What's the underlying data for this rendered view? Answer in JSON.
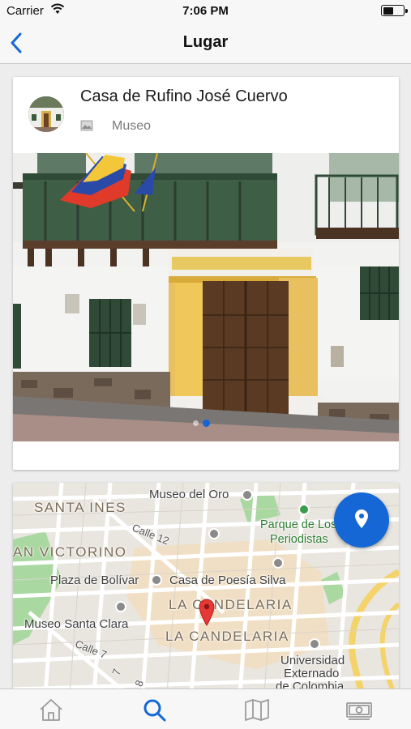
{
  "status_bar": {
    "carrier": "Carrier",
    "time": "7:06 PM"
  },
  "nav": {
    "title": "Lugar",
    "back_icon": "chevron-left-icon"
  },
  "place": {
    "name": "Casa de Rufino José Cuervo",
    "category": "Museo",
    "category_icon": "image-icon",
    "photo_pages": 2,
    "active_photo": 2
  },
  "map": {
    "labels": {
      "museo_del_oro": "Museo del Oro",
      "santa_ines": "SANTA INES",
      "calle_12": "Calle 12",
      "parque": "Parque de Los",
      "periodistas": "Periodistas",
      "san_victorino": "AN VICTORINO",
      "plaza_bolivar": "Plaza de Bolívar",
      "casa_poesia": "Casa de Poesía Silva",
      "la_candelaria_1": "LA CANDELARIA",
      "la_candelaria_2": "LA CANDELARIA",
      "museo_santa_clara": "Museo Santa Clara",
      "calle_7": "Calle 7",
      "universidad_1": "Universidad",
      "universidad_2": "Externado",
      "universidad_3": "de Colombia",
      "carrera_7": "7",
      "carrera_8": "8"
    },
    "fab_icon": "location-pin-icon"
  },
  "tabs": [
    {
      "name": "home",
      "icon": "home-icon",
      "active": false
    },
    {
      "name": "search",
      "icon": "search-icon",
      "active": true
    },
    {
      "name": "map",
      "icon": "map-icon",
      "active": false
    },
    {
      "name": "money",
      "icon": "banknote-icon",
      "active": false
    }
  ],
  "colors": {
    "accent": "#1467d4",
    "tab_inactive": "#9a9a9a",
    "pin": "#e53935"
  }
}
